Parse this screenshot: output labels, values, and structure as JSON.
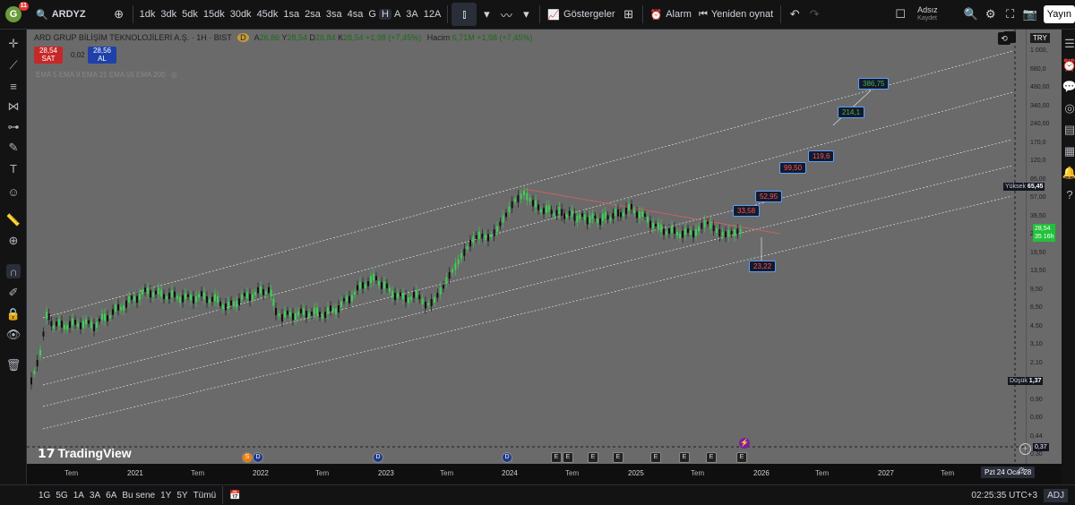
{
  "header": {
    "logo_letter": "G",
    "notifications": "11",
    "symbol": "ARDYZ",
    "timeframes": [
      "1dk",
      "3dk",
      "5dk",
      "15dk",
      "30dk",
      "45dk",
      "1sa",
      "2sa",
      "3sa",
      "4sa",
      "G",
      "H",
      "A",
      "3A",
      "12A"
    ],
    "active_timeframe": "H",
    "indicators_label": "Göstergeler",
    "alert_label": "Alarm",
    "replay_label": "Yeniden oynat",
    "layout_name": "Adsız",
    "layout_status": "Kaydet",
    "publish_label": "Yayın"
  },
  "legend": {
    "title": "ARD GRUP BİLİŞİM TEKNOLOJİLERİ A.Ş. · 1H · BIST",
    "o_label": "A",
    "o_val": "26,86",
    "h_label": "Y",
    "h_val": "28,54",
    "l_label": "D",
    "l_val": "26,84",
    "c_label": "K",
    "c_val": "28,54",
    "change": "+1,98 (+7,45%)",
    "volume_label": "Hacim",
    "volume_val": "6,71M",
    "volume_change": "+1,98 (+7,45%)",
    "sell_price": "28,54",
    "sell_label": "SAT",
    "spread": "0,02",
    "buy_price": "28,56",
    "buy_label": "AL",
    "ema_line": "EMA 5 EMA 9 EMA 21 EMA 55 EMA 200"
  },
  "chart": {
    "watermark": "TradingView",
    "targets": [
      {
        "label": "386,75",
        "color": "green"
      },
      {
        "label": "214,1",
        "color": "green"
      },
      {
        "label": "119,6",
        "color": "red"
      },
      {
        "label": "99,50",
        "color": "red"
      },
      {
        "label": "52,95",
        "color": "red"
      },
      {
        "label": "33,58",
        "color": "red"
      },
      {
        "label": "23,22",
        "color": "red"
      }
    ]
  },
  "price_axis": {
    "currency": "TRY",
    "ticks": [
      "1.000,",
      "680,0",
      "480,00",
      "340,00",
      "240,00",
      "170,0",
      "120,0",
      "85,00",
      "57,00",
      "39,50",
      "27,50",
      "19,50",
      "13,50",
      "9,50",
      "6,50",
      "4,50",
      "3,10",
      "2,10",
      "1,50",
      "0,90",
      "0,60",
      "0,44",
      "0,30"
    ],
    "high_label": "Yüksek",
    "high_val": "65,45",
    "current_val": "28,54",
    "countdown": "35 16h",
    "low_label": "Düşük",
    "low_val": "1,37",
    "cursor_val": "0,37"
  },
  "time_axis": {
    "ticks": [
      "Tem",
      "2021",
      "Tem",
      "2022",
      "Tem",
      "2023",
      "Tem",
      "2024",
      "Tem",
      "2025",
      "Tem",
      "2026",
      "Tem",
      "2027",
      "Tem"
    ],
    "cursor_date": "Pzt 24 Oca '28"
  },
  "events": [
    "S",
    "D",
    "D",
    "D",
    "E",
    "E",
    "E",
    "E",
    "E",
    "E",
    "E",
    "E"
  ],
  "footer": {
    "ranges": [
      "1G",
      "5G",
      "1A",
      "3A",
      "6A",
      "Bu sene",
      "1Y",
      "5Y",
      "Tümü"
    ],
    "clock": "02:25:35 UTC+3",
    "adj": "ADJ"
  }
}
